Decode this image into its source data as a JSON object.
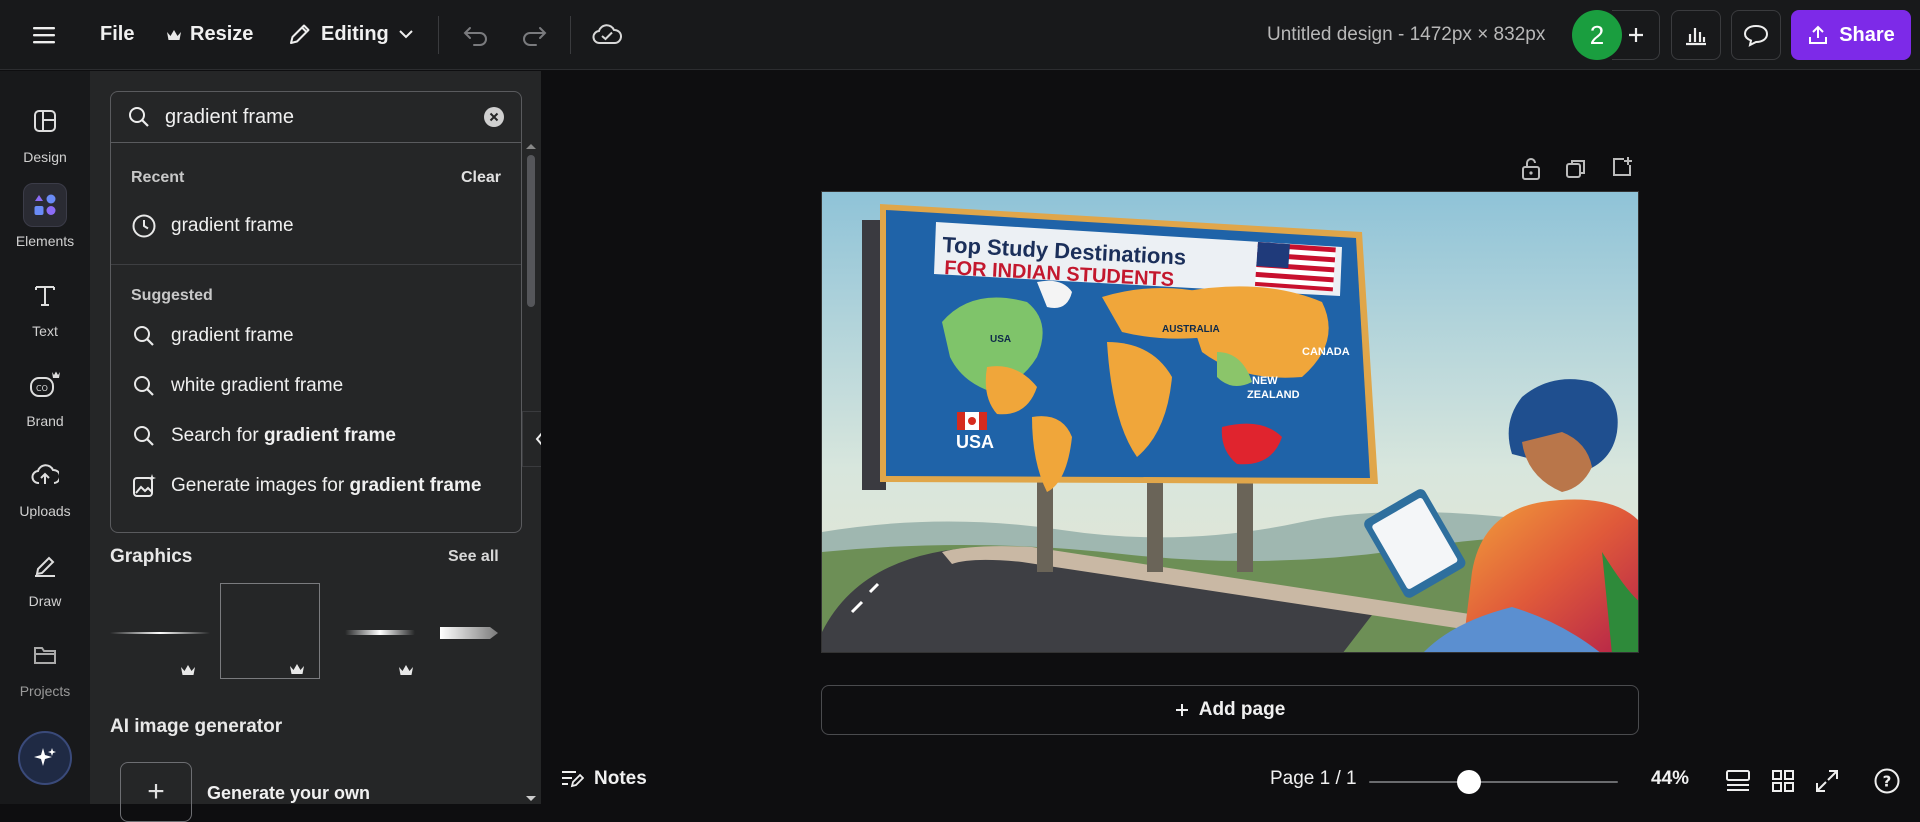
{
  "header": {
    "menu_icon": "hamburger-icon",
    "file_label": "File",
    "resize_label": "Resize",
    "editing_label": "Editing",
    "doc_title": "Untitled design - 1472px × 832px",
    "avatar_count": "2",
    "share_label": "Share",
    "brand_color": "#7d2ae8"
  },
  "rail": {
    "items": [
      {
        "label": "Design",
        "icon": "layout-icon"
      },
      {
        "label": "Elements",
        "icon": "shapes-icon"
      },
      {
        "label": "Text",
        "icon": "text-icon"
      },
      {
        "label": "Brand",
        "icon": "brand-icon"
      },
      {
        "label": "Uploads",
        "icon": "cloud-upload-icon"
      },
      {
        "label": "Draw",
        "icon": "pen-icon"
      },
      {
        "label": "Projects",
        "icon": "folder-icon"
      }
    ]
  },
  "search": {
    "value": "gradient frame"
  },
  "dropdown": {
    "recent_heading": "Recent",
    "clear_label": "Clear",
    "recent_item": "gradient frame",
    "suggested_heading": "Suggested",
    "suggested": [
      "gradient frame",
      "white gradient frame"
    ],
    "search_for_prefix": "Search for ",
    "search_for_term": "gradient frame",
    "generate_prefix": "Generate images for ",
    "generate_term": "gradient frame"
  },
  "graphics": {
    "title": "Graphics",
    "see_all": "See all"
  },
  "ai": {
    "title": "AI image generator",
    "generate_label": "Generate your own"
  },
  "canvas": {
    "billboard_title_line1": "Top Study Destinations",
    "billboard_title_line2": "FOR INDIAN STUDENTS",
    "map_labels": {
      "usa_map": "USA",
      "australia": "AUSTRALIA",
      "canada": "CANADA",
      "new_zealand_1": "NEW",
      "new_zealand_2": "ZEALAND",
      "usa_badge": "USA"
    },
    "add_page_label": "Add page"
  },
  "footer": {
    "notes_label": "Notes",
    "page_indicator": "Page 1 / 1",
    "zoom": "44%",
    "zoom_fraction": 0.44
  }
}
